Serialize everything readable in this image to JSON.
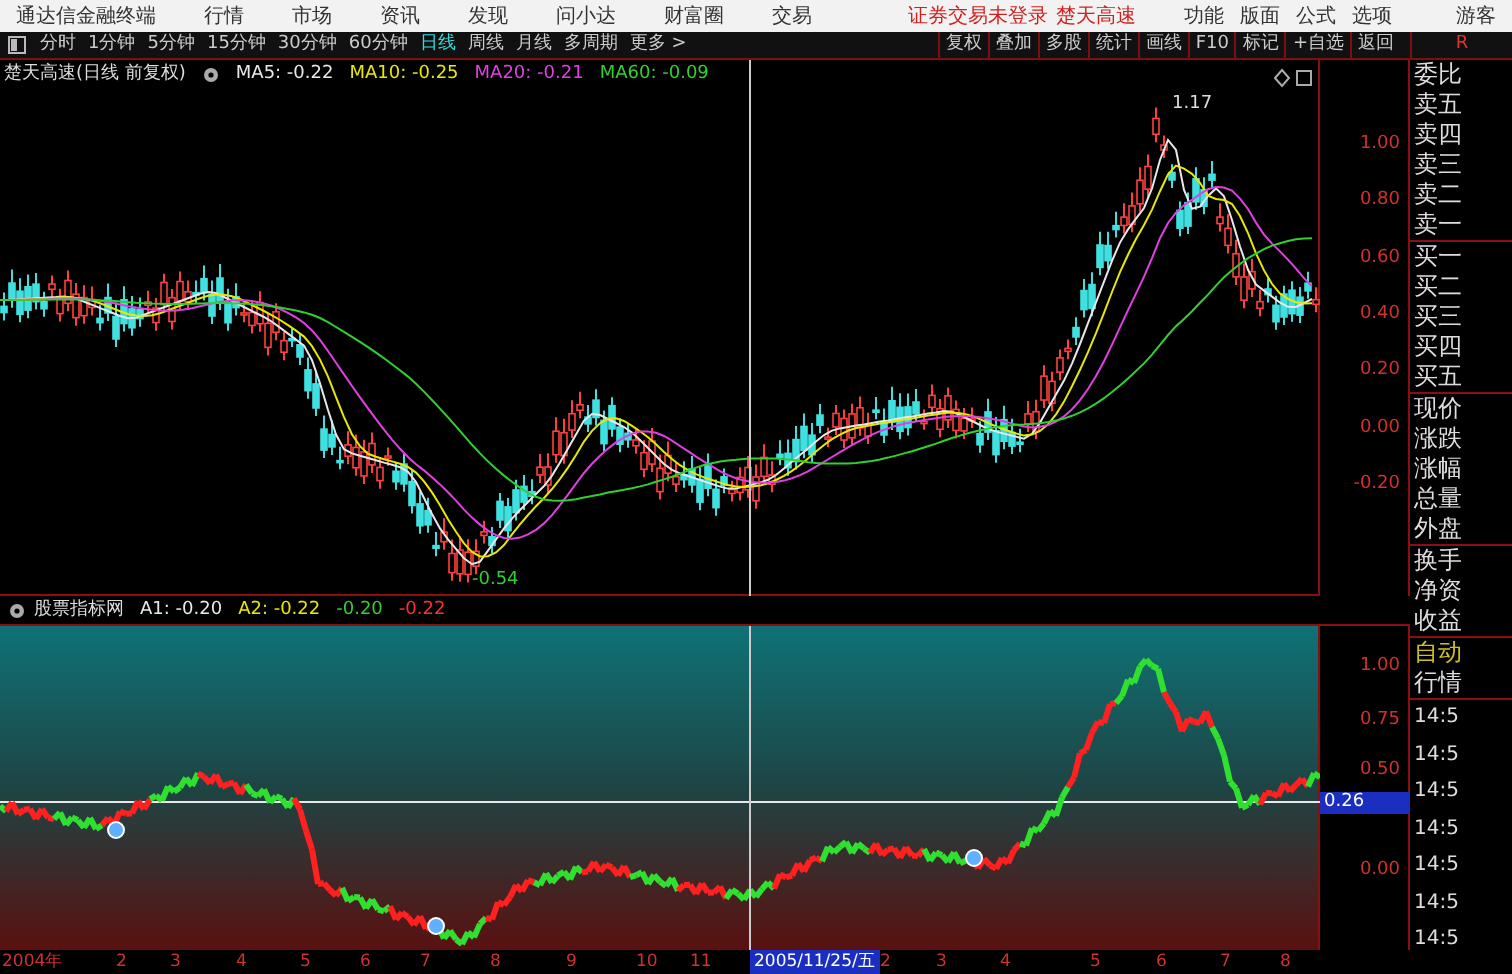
{
  "menu_bar": {
    "app_title": "通达信金融终端",
    "menus": [
      "行情",
      "市场",
      "资讯",
      "发现",
      "问小达",
      "财富圈",
      "交易"
    ],
    "login_notice": "证券交易未登录",
    "stock_name": "楚天高速",
    "right_menus": [
      "功能",
      "版面",
      "公式",
      "选项"
    ],
    "user": "游客"
  },
  "period_tabs": [
    {
      "label": "分时",
      "selected": false
    },
    {
      "label": "1分钟",
      "selected": false
    },
    {
      "label": "5分钟",
      "selected": false
    },
    {
      "label": "15分钟",
      "selected": false
    },
    {
      "label": "30分钟",
      "selected": false
    },
    {
      "label": "60分钟",
      "selected": false
    },
    {
      "label": "日线",
      "selected": true
    },
    {
      "label": "周线",
      "selected": false
    },
    {
      "label": "月线",
      "selected": false
    },
    {
      "label": "多周期",
      "selected": false
    },
    {
      "label": "更多 >",
      "selected": false
    }
  ],
  "chart_tools": [
    "复权",
    "叠加",
    "多股",
    "统计",
    "画线",
    "F10",
    "标记",
    "+自选",
    "返回"
  ],
  "corner_label": "R",
  "main_chart": {
    "title": "楚天高速(日线 前复权)",
    "legend": [
      {
        "label": "MA5: -0.22",
        "color": "#e8e8e8"
      },
      {
        "label": "MA10: -0.25",
        "color": "#e8e800"
      },
      {
        "label": "MA20: -0.21",
        "color": "#e040e0"
      },
      {
        "label": "MA60: -0.09",
        "color": "#30d030"
      }
    ],
    "high_label": "1.17",
    "low_label": "-0.54",
    "y_axis": [
      "1.00",
      "0.80",
      "0.60",
      "0.40",
      "0.20",
      "0.00",
      "-0.20"
    ]
  },
  "indicator": {
    "title": "股票指标网",
    "legend": [
      {
        "label": "A1: -0.20",
        "color": "#e8e8e8"
      },
      {
        "label": "A2: -0.22",
        "color": "#e8e800"
      },
      {
        "label": "-0.20",
        "color": "#30d030"
      },
      {
        "label": "-0.22",
        "color": "#ff3030"
      }
    ],
    "y_axis": [
      "1.00",
      "0.75",
      "0.50",
      "0.00"
    ],
    "cursor_value": "0.26"
  },
  "dates": [
    "2004年",
    "2",
    "3",
    "4",
    "5",
    "6",
    "7",
    "8",
    "9",
    "10",
    "11",
    "2",
    "3",
    "4",
    "5",
    "6",
    "7",
    "8"
  ],
  "cursor_date": "2005/11/25/五",
  "quote_panel": {
    "rows": [
      "委比",
      "卖五",
      "卖四",
      "卖三",
      "卖二",
      "卖一",
      "买一",
      "买二",
      "买三",
      "买四",
      "买五",
      "现价",
      "涨跌",
      "涨幅",
      "总量",
      "外盘",
      "换手",
      "净资",
      "收益"
    ],
    "auto_label": "自动",
    "trade_label": "行情",
    "times": [
      "14:5",
      "14:5",
      "14:5",
      "14:5",
      "14:5",
      "14:5",
      "14:5"
    ]
  }
}
